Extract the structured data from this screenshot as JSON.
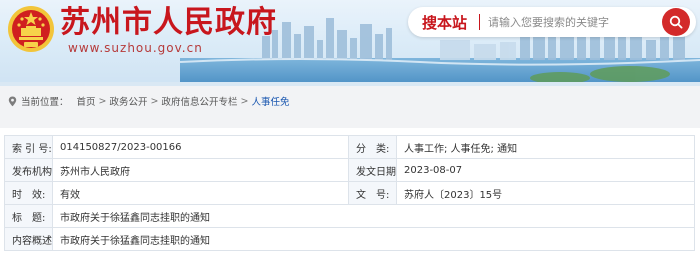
{
  "header": {
    "site_title": "苏州市人民政府",
    "site_url": "www.suzhou.gov.cn",
    "emblem_icon": "national-emblem-icon",
    "brand_color": "#c8161d"
  },
  "search": {
    "brand_label": "搜本站",
    "placeholder": "请输入您要搜索的关键字",
    "button_icon": "search-icon"
  },
  "breadcrumb": {
    "label": "当前位置：",
    "items": [
      "首页",
      "政务公开",
      "政府信息公开专栏"
    ],
    "current": "人事任免",
    "separator": ">"
  },
  "info": {
    "rows": [
      {
        "k1": "索 引 号:",
        "v1": "014150827/2023-00166",
        "k2": "分　类:",
        "v2": "人事工作;  人事任免;  通知"
      },
      {
        "k1": "发布机构:",
        "v1": "苏州市人民政府",
        "k2": "发文日期:",
        "v2": "2023-08-07"
      },
      {
        "k1": "时　效:",
        "v1": "有效",
        "k2": "文　号:",
        "v2": "苏府人〔2023〕15号"
      }
    ],
    "title_label": "标　题:",
    "title_value": "市政府关于徐猛鑫同志挂职的通知",
    "summary_label": "内容概述:",
    "summary_value": "市政府关于徐猛鑫同志挂职的通知"
  }
}
